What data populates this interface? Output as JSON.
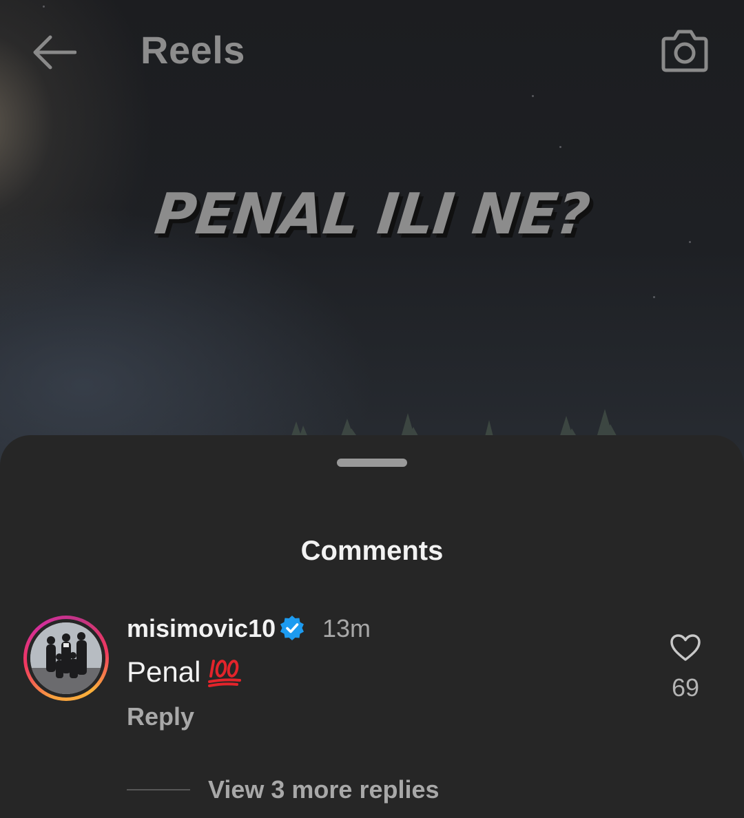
{
  "header": {
    "title": "Reels",
    "back_icon": "arrow-left-icon",
    "camera_icon": "camera-icon"
  },
  "video": {
    "overlay_text": "PENAL ILI NE?"
  },
  "comments_sheet": {
    "title": "Comments",
    "comments": [
      {
        "username": "misimovic10",
        "verified": true,
        "time": "13m",
        "text": "Penal",
        "emoji": "💯",
        "reply_label": "Reply",
        "likes": "69",
        "more_replies_label": "View 3 more replies"
      }
    ]
  },
  "colors": {
    "ring_gradient": [
      "#f9a03f",
      "#f0385f",
      "#c13584"
    ],
    "verified_blue": "#1d9bf0",
    "sheet_bg": "#262626"
  }
}
